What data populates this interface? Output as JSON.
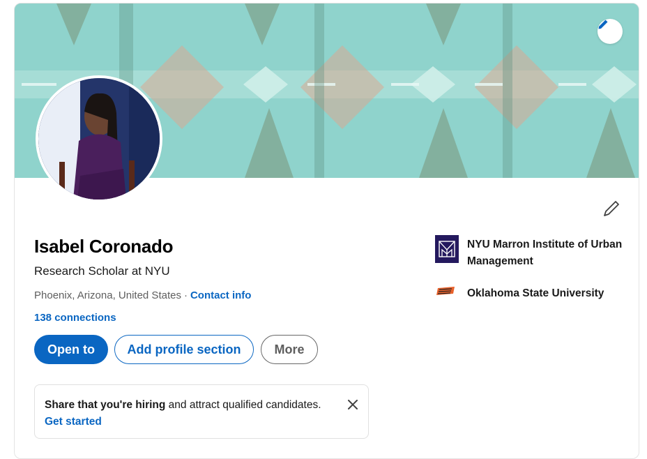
{
  "profile": {
    "name": "Isabel Coronado",
    "headline": "Research Scholar at NYU",
    "location": "Phoenix, Arizona, United States",
    "separator": "·",
    "contact_label": "Contact info",
    "connections": "138 connections"
  },
  "actions": {
    "open_to": "Open to",
    "add_section": "Add profile section",
    "more": "More"
  },
  "hiring": {
    "bold_text": "Share that you're hiring",
    "rest_text": " and attract qualified candidates.",
    "link": "Get started"
  },
  "education": [
    {
      "name": "NYU Marron Institute of Urban Management",
      "logo": "nyu-marron-logo"
    },
    {
      "name": "Oklahoma State University",
      "logo": "osu-logo"
    }
  ],
  "colors": {
    "accent": "#0a66c2",
    "banner": "#8fd3cc",
    "nyu_logo_bg": "#24195e",
    "osu_orange": "#e8612b"
  },
  "icons": {
    "banner_edit": "pencil-icon",
    "intro_edit": "pencil-icon",
    "dismiss": "close-icon"
  }
}
